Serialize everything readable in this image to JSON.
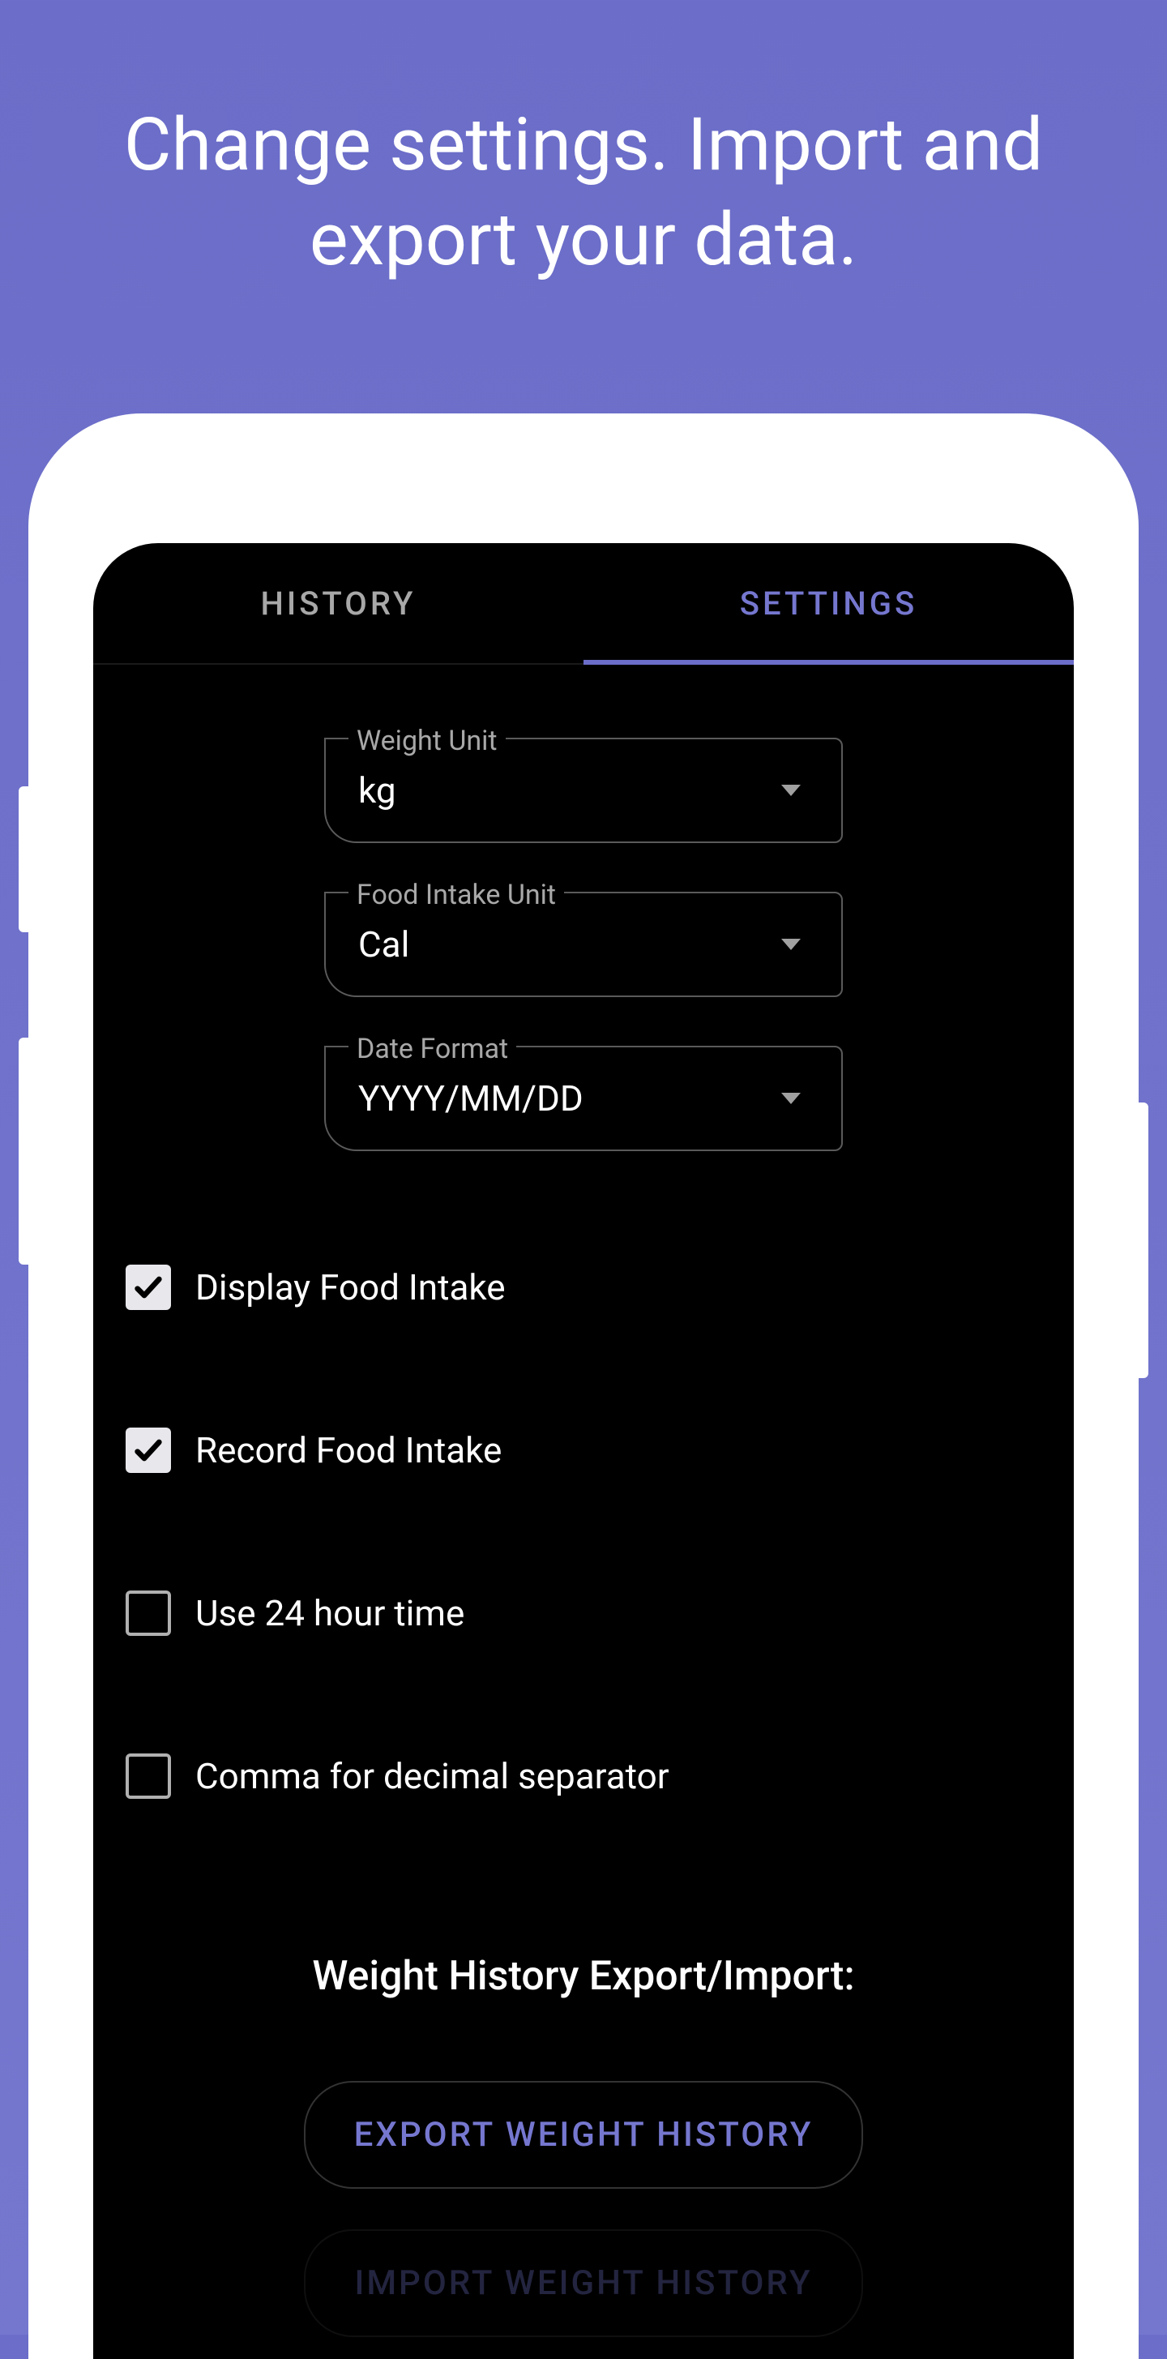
{
  "promo": {
    "text": "Change settings. Import and export your data."
  },
  "tabs": {
    "history": "HISTORY",
    "settings": "SETTINGS"
  },
  "dropdowns": {
    "weight_unit": {
      "label": "Weight Unit",
      "value": "kg"
    },
    "food_unit": {
      "label": "Food Intake Unit",
      "value": "Cal"
    },
    "date_format": {
      "label": "Date Format",
      "value": "YYYY/MM/DD"
    }
  },
  "checkboxes": {
    "display_food": {
      "label": "Display Food Intake",
      "checked": true
    },
    "record_food": {
      "label": "Record Food Intake",
      "checked": true
    },
    "use_24h": {
      "label": "Use 24 hour time",
      "checked": false
    },
    "comma_decimal": {
      "label": "Comma for decimal separator",
      "checked": false
    }
  },
  "section": {
    "heading": "Weight History Export/Import:"
  },
  "buttons": {
    "export": "EXPORT WEIGHT HISTORY",
    "import": "IMPORT WEIGHT HISTORY"
  }
}
